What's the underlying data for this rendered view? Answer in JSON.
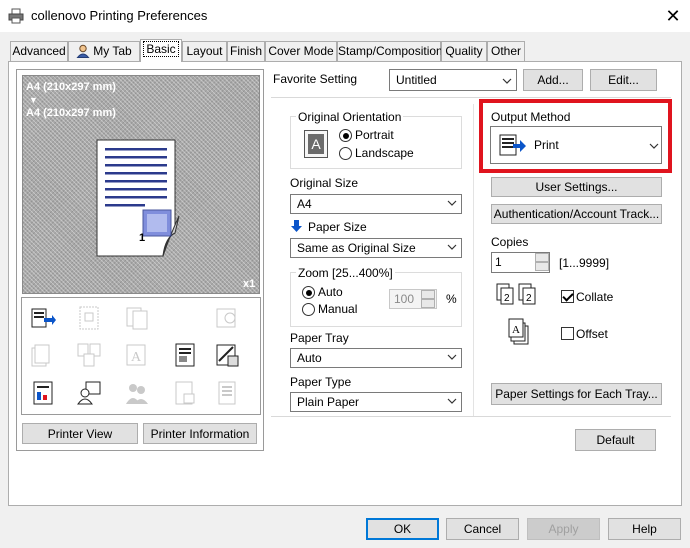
{
  "window": {
    "title": "collenovo Printing Preferences",
    "close_glyph": "✕"
  },
  "tabs": [
    {
      "label": "Advanced"
    },
    {
      "label": "My Tab"
    },
    {
      "label": "Basic",
      "active": true
    },
    {
      "label": "Layout"
    },
    {
      "label": "Finish"
    },
    {
      "label": "Cover Mode"
    },
    {
      "label": "Stamp/Composition"
    },
    {
      "label": "Quality"
    },
    {
      "label": "Other"
    }
  ],
  "preview": {
    "line1": "A4 (210x297 mm)",
    "arrow": "▼",
    "line2": "A4 (210x297 mm)",
    "copies_badge": "x1",
    "page_number": "1"
  },
  "left_buttons": {
    "printer_view": "Printer View",
    "printer_information": "Printer Information"
  },
  "favorite": {
    "label": "Favorite Setting",
    "value": "Untitled",
    "add_label": "Add...",
    "edit_label": "Edit..."
  },
  "orientation": {
    "group_label": "Original Orientation",
    "portrait": "Portrait",
    "landscape": "Landscape",
    "selected": "Portrait",
    "icon_letter": "A"
  },
  "original_size": {
    "label": "Original Size",
    "value": "A4"
  },
  "paper_size": {
    "label": "Paper Size",
    "value": "Same as Original Size"
  },
  "zoom": {
    "group_label": "Zoom [25...400%]",
    "auto": "Auto",
    "manual": "Manual",
    "selected": "Auto",
    "value": "100",
    "unit": "%"
  },
  "paper_tray": {
    "label": "Paper Tray",
    "value": "Auto"
  },
  "paper_type": {
    "label": "Paper Type",
    "value": "Plain Paper"
  },
  "output_method": {
    "label": "Output Method",
    "value": "Print"
  },
  "user_settings": "User Settings...",
  "auth_tracking": "Authentication/Account Track...",
  "copies": {
    "label": "Copies",
    "value": "1",
    "range": "[1...9999]"
  },
  "collate": {
    "label": "Collate",
    "checked": true
  },
  "offset": {
    "label": "Offset",
    "checked": false
  },
  "paper_settings_each_tray": "Paper Settings for Each Tray...",
  "default_button": "Default",
  "footer": {
    "ok": "OK",
    "cancel": "Cancel",
    "apply": "Apply",
    "help": "Help"
  },
  "colors": {
    "highlight": "#e0141e",
    "accent": "#0078d7",
    "doc_lines": "#2b3a8c"
  }
}
